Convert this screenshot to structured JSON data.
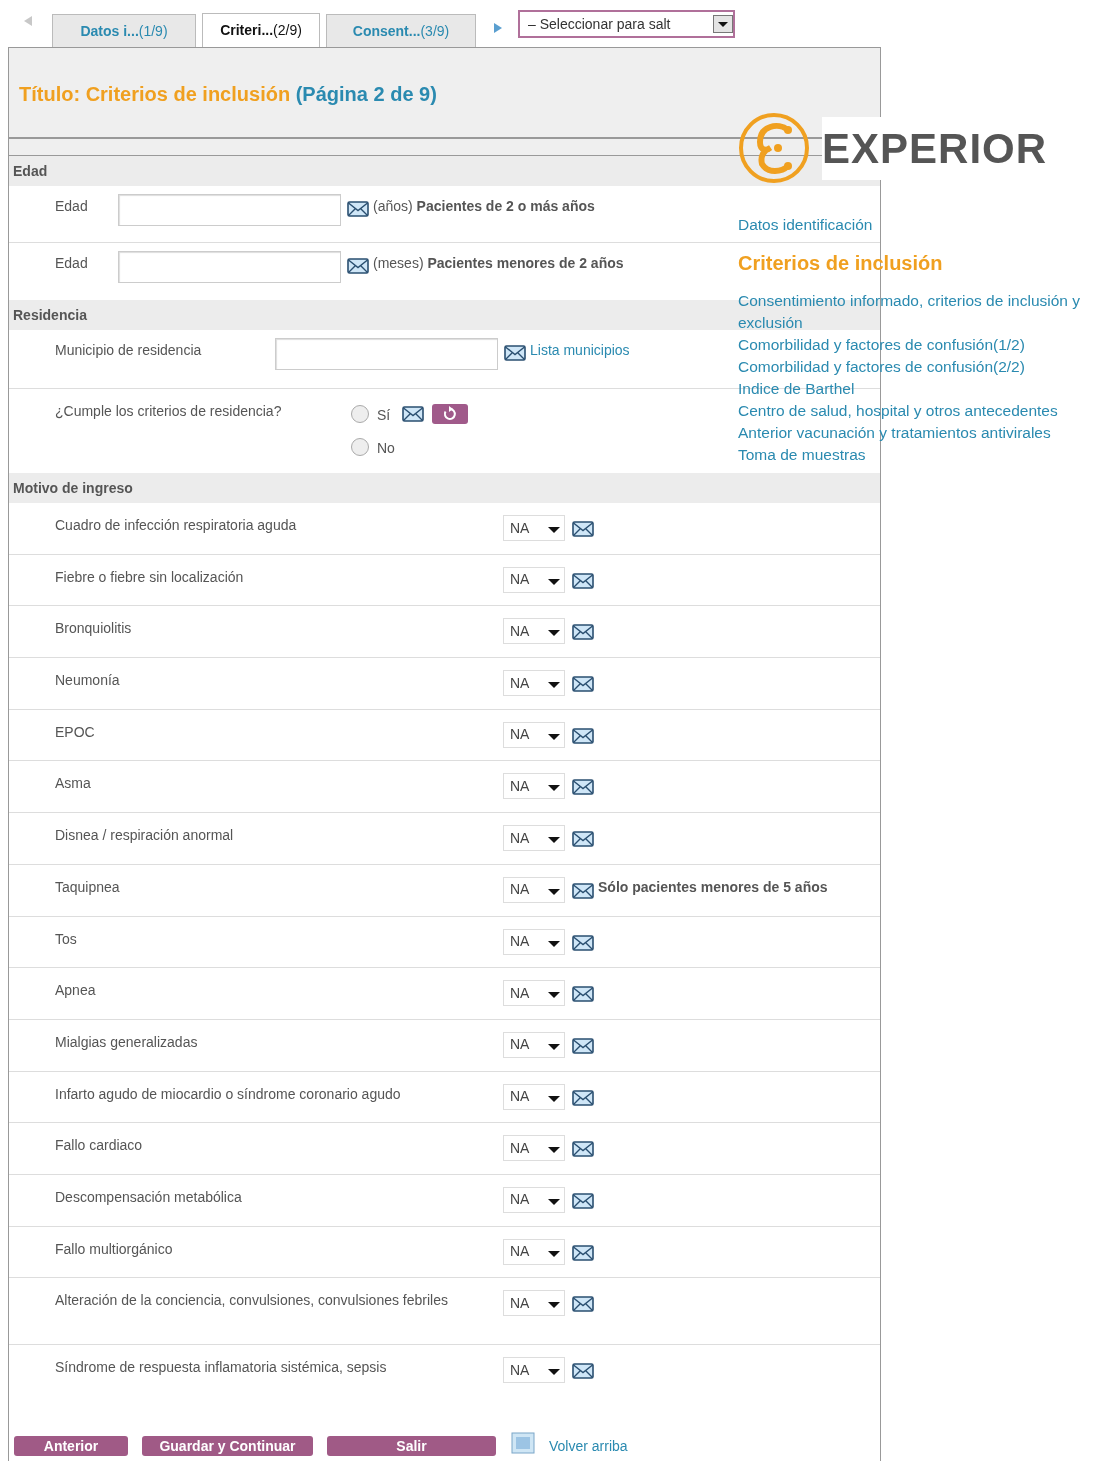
{
  "tabs": [
    {
      "name": "Datos i...",
      "count": "(1/9)",
      "selected": false
    },
    {
      "name": "Criteri...",
      "count": "(2/9)",
      "selected": true
    },
    {
      "name": "Consent...",
      "count": "(3/9)",
      "selected": false
    }
  ],
  "jump_select": {
    "value": "– Seleccionar para salt"
  },
  "title": {
    "text": "Título: Criterios de inclusión",
    "page": "(Página 2 de 9)"
  },
  "sections": [
    {
      "heading": "Edad",
      "rows": [
        {
          "kind": "text_input",
          "label": "Edad",
          "hint": "(años) **Pacientes de 2 o más años**"
        },
        {
          "kind": "text_input",
          "label": "Edad",
          "hint": "(meses) **Pacientes menores de 2 años**"
        }
      ]
    },
    {
      "heading": "Residencia",
      "rows": [
        {
          "kind": "text_input",
          "label": "Municipio de residencia",
          "link": "Lista municipios"
        },
        {
          "kind": "radio",
          "label": "¿Cumple los criterios de residencia?",
          "options": [
            {
              "label": "Sí",
              "selected": false
            },
            {
              "label": "No",
              "selected": false
            }
          ]
        }
      ]
    },
    {
      "heading": "Motivo de ingreso",
      "rows": [
        {
          "kind": "select",
          "label": "Cuadro de infección respiratoria aguda",
          "value": "NA"
        },
        {
          "kind": "select",
          "label": "Fiebre o fiebre sin localización",
          "value": "NA"
        },
        {
          "kind": "select",
          "label": "Bronquiolitis",
          "value": "NA"
        },
        {
          "kind": "select",
          "label": "Neumonía",
          "value": "NA"
        },
        {
          "kind": "select",
          "label": "EPOC",
          "value": "NA"
        },
        {
          "kind": "select",
          "label": "Asma",
          "value": "NA"
        },
        {
          "kind": "select",
          "label": "Disnea / respiración anormal",
          "value": "NA"
        },
        {
          "kind": "select",
          "label": "Taquipnea",
          "value": "NA",
          "note": "Sólo pacientes menores de 5 años"
        },
        {
          "kind": "select",
          "label": "Tos",
          "value": "NA"
        },
        {
          "kind": "select",
          "label": "Apnea",
          "value": "NA"
        },
        {
          "kind": "select",
          "label": "Mialgias generalizadas",
          "value": "NA"
        },
        {
          "kind": "select",
          "label": "Infarto agudo de miocardio o síndrome coronario agudo",
          "value": "NA"
        },
        {
          "kind": "select",
          "label": "Fallo cardiaco",
          "value": "NA"
        },
        {
          "kind": "select",
          "label": "Descompensación metabólica",
          "value": "NA"
        },
        {
          "kind": "select",
          "label": "Fallo multiorgánico",
          "value": "NA"
        },
        {
          "kind": "select",
          "label": "Alteración de la conciencia, convulsiones, convulsiones febriles",
          "value": "NA"
        },
        {
          "kind": "select",
          "label": "Síndrome de respuesta inflamatoria sistémica, sepsis",
          "value": "NA"
        }
      ]
    }
  ],
  "buttons": [
    "Anterior",
    "Guardar y Continuar",
    "Salir"
  ],
  "back_to_top": "Volver arriba",
  "sidebar": {
    "logo": "EXPERIOR",
    "items": [
      {
        "label": "Datos identificación",
        "selected": false
      },
      {
        "label": "Criterios de inclusión",
        "selected": true
      },
      {
        "label": "Consentimiento informado, criterios de inclusión y exclusión",
        "selected": false
      },
      {
        "label": "Comorbilidad y factores de confusión(1/2)",
        "selected": false
      },
      {
        "label": "Comorbilidad y factores de confusión(2/2)",
        "selected": false
      },
      {
        "label": "Indice de Barthel",
        "selected": false
      },
      {
        "label": "Centro de salud, hospital y otros antecedentes",
        "selected": false
      },
      {
        "label": "Anterior vacunación y tratamientos antivirales",
        "selected": false
      },
      {
        "label": "Toma de muestras",
        "selected": false
      }
    ]
  }
}
